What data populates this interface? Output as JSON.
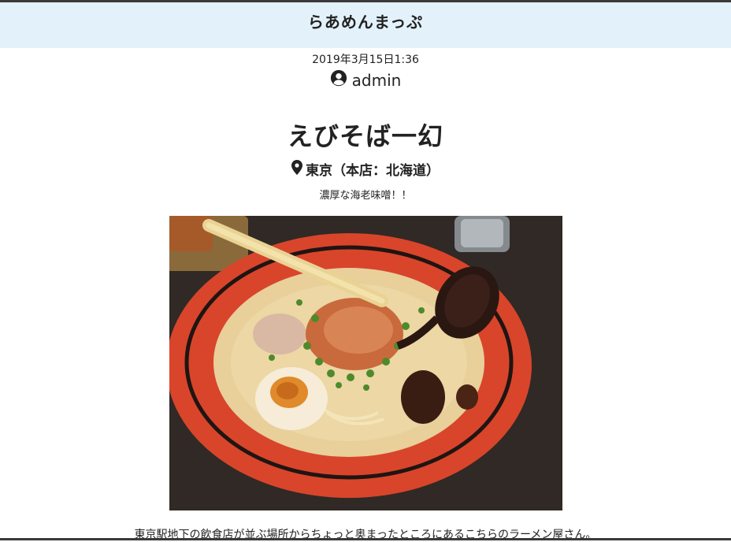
{
  "header": {
    "site_title": "らあめんまっぷ"
  },
  "post": {
    "date": "2019年3月15日1:36",
    "author": "admin",
    "author_icon": "user-circle-icon",
    "title": "えびそば一幻",
    "location": "東京（本店：北海道）",
    "location_icon": "map-pin-icon",
    "tagline": "濃厚な海老味噌！！",
    "body_text": "東京駅地下の飲食店が並ぶ場所からちょっと奥まったところにあるこちらのラーメン屋さん。"
  },
  "colors": {
    "header_bg": "#e3f1fb",
    "bowl_red": "#d8452b",
    "broth": "#e9cf9a"
  }
}
